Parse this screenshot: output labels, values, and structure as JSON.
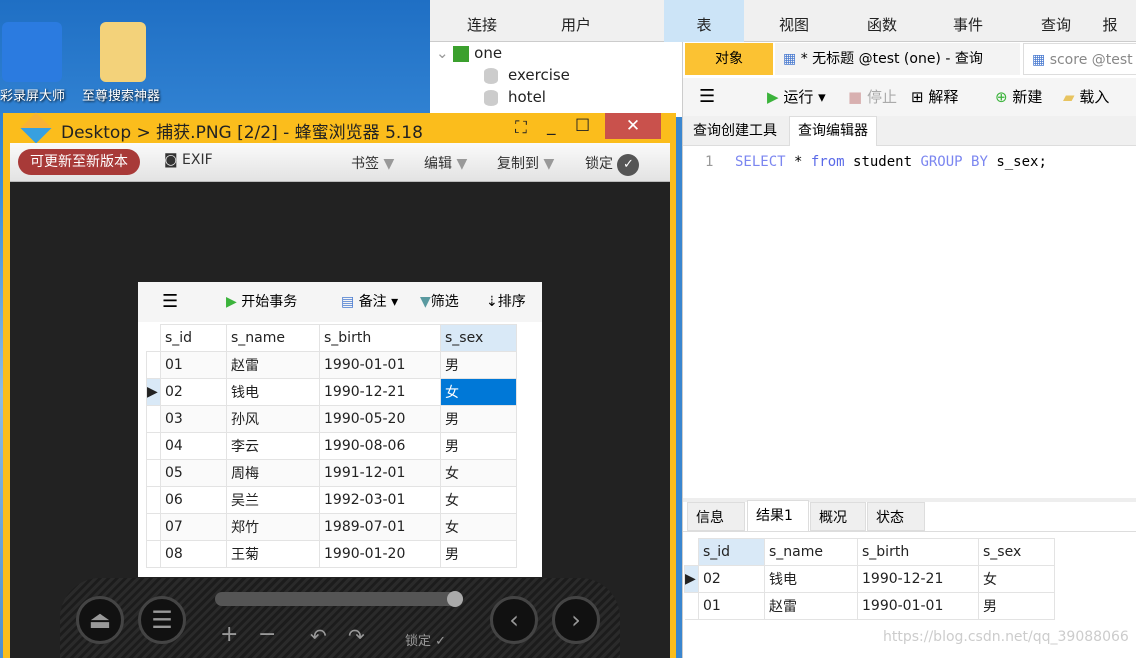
{
  "desktop": {
    "icons": [
      {
        "label": "彩录屏大师"
      },
      {
        "label": "至尊搜索神器"
      }
    ]
  },
  "navicat": {
    "toolbar": [
      "连接",
      "用户",
      "表",
      "视图",
      "函数",
      "事件",
      "查询",
      "报"
    ],
    "active_toolbar": "表",
    "tree": {
      "connection": "one",
      "databases": [
        "exercise",
        "hotel"
      ]
    },
    "tabs": {
      "objects": "对象",
      "query_tab": "* 无标题 @test (one) - 查询",
      "score_tab": "score @test"
    },
    "query_toolbar": {
      "run": "运行",
      "stop": "停止",
      "explain": "解释",
      "new": "新建",
      "load": "载入"
    },
    "subtabs": [
      "查询创建工具",
      "查询编辑器"
    ],
    "editor": {
      "line": "1",
      "kw1": "SELECT",
      "star": " * ",
      "kw2": "from",
      "t1": " student ",
      "kw3": "GROUP BY",
      "t2": " s_sex;"
    },
    "result_tabs": [
      "信息",
      "结果1",
      "概况",
      "状态"
    ],
    "result": {
      "columns": [
        "s_id",
        "s_name",
        "s_birth",
        "s_sex"
      ],
      "rows": [
        [
          "02",
          "钱电",
          "1990-12-21",
          "女"
        ],
        [
          "01",
          "赵雷",
          "1990-01-01",
          "男"
        ]
      ]
    },
    "watermark": "https://blog.csdn.net/qq_39088066"
  },
  "browser": {
    "title": "Desktop > 捕获.PNG [2/2] - 蜂蜜浏览器 5.18",
    "update_btn": "可更新至新版本",
    "exif": "EXIF",
    "bookmarks": "书签",
    "edit": "编辑",
    "copy_to": "复制到",
    "lock": "锁定",
    "bottom_lock": "锁定",
    "image": {
      "toolbar": {
        "begin": "开始事务",
        "note": "备注",
        "filter": "筛选",
        "sort": "排序"
      },
      "columns": [
        "s_id",
        "s_name",
        "s_birth",
        "s_sex"
      ],
      "rows": [
        [
          "01",
          "赵雷",
          "1990-01-01",
          "男"
        ],
        [
          "02",
          "钱电",
          "1990-12-21",
          "女"
        ],
        [
          "03",
          "孙风",
          "1990-05-20",
          "男"
        ],
        [
          "04",
          "李云",
          "1990-08-06",
          "男"
        ],
        [
          "05",
          "周梅",
          "1991-12-01",
          "女"
        ],
        [
          "06",
          "吴兰",
          "1992-03-01",
          "女"
        ],
        [
          "07",
          "郑竹",
          "1989-07-01",
          "女"
        ],
        [
          "08",
          "王菊",
          "1990-01-20",
          "男"
        ]
      ]
    }
  }
}
